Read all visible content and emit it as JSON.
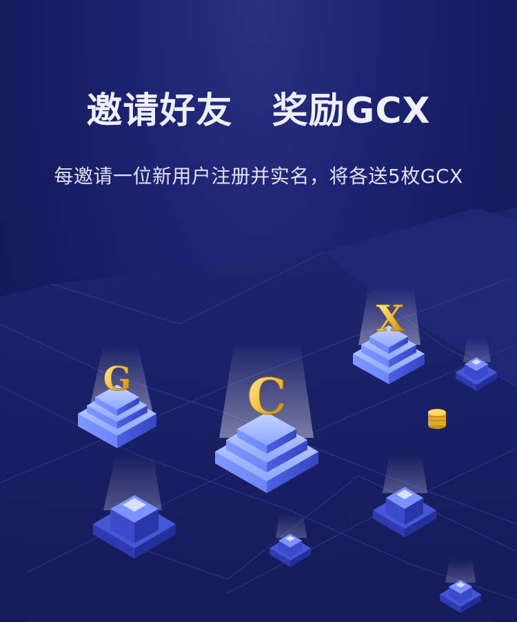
{
  "header": {
    "title": "邀请好友   奖励GCX",
    "subtitle": "每邀请一位新用户注册并实名，将各送5枚GCX"
  },
  "illustration": {
    "letters": [
      "G",
      "C",
      "X"
    ],
    "icons": [
      "coin-stack-icon"
    ]
  },
  "colors": {
    "background": "#161b5e",
    "gold": "#f2c64a",
    "platform": "#8aa8ff"
  }
}
